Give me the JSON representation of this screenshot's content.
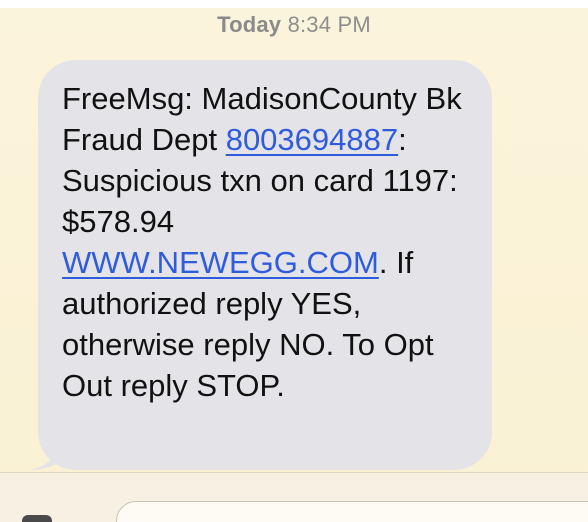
{
  "header": {
    "timestamp_day": "Today",
    "timestamp_time": "8:34 PM"
  },
  "message": {
    "part_1": "FreeMsg: MadisonCounty Bk Fraud Dept ",
    "phone_link": "8003694887",
    "part_2": ": Suspicious txn on card 1197: $578.94 ",
    "url_link": "WWW.NEWEGG.COM",
    "part_3": ". If authorized reply YES, otherwise reply NO. To Opt Out reply STOP."
  },
  "colors": {
    "bubble": "#e4e4e8",
    "link": "#2f5bdd",
    "background": "#fbf4dc",
    "timestamp": "#8e8e8e"
  },
  "icons": {
    "composer_left": "camera-icon"
  }
}
